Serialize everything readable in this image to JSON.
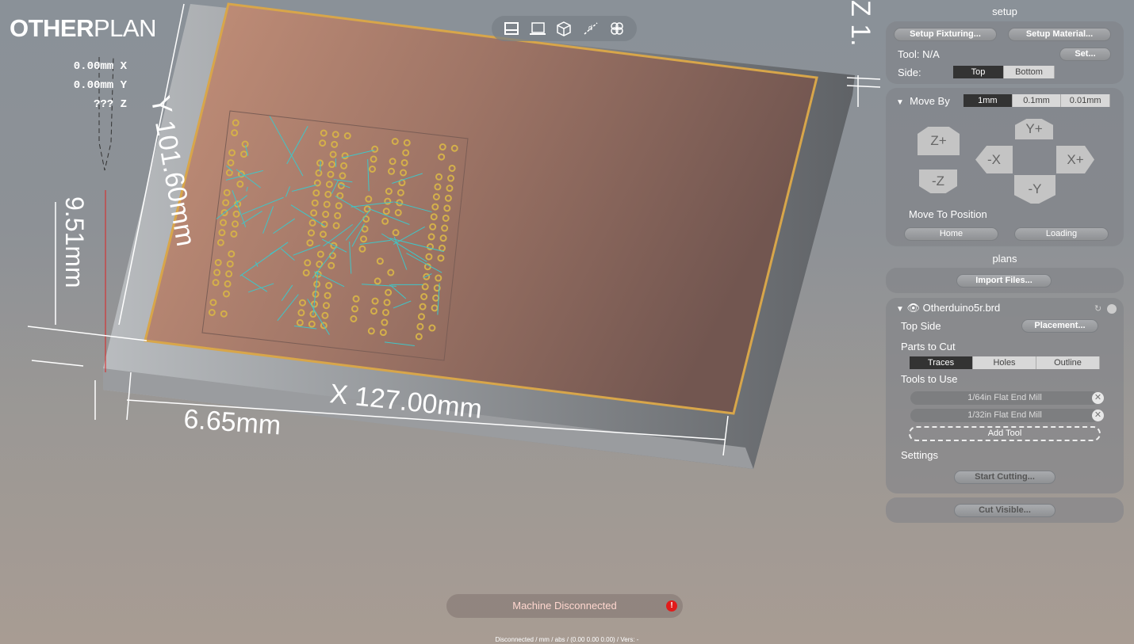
{
  "app": {
    "logo_bold": "OTHER",
    "logo_light": "PLAN"
  },
  "readout": {
    "x": "0.00mm X",
    "y": "0.00mm Y",
    "z": "??? Z"
  },
  "toolbar": {
    "icons": [
      "top-view-icon",
      "front-view-icon",
      "iso-view-icon",
      "measure-icon",
      "layers-icon"
    ]
  },
  "dimensions": {
    "y": "Y 101.60mm",
    "x": "X 127.00mm",
    "offset_y": "9.51mm",
    "offset_x": "6.65mm",
    "z": "Z 1."
  },
  "setup": {
    "title": "setup",
    "fixturing": "Setup Fixturing...",
    "material": "Setup Material...",
    "tool_label": "Tool:",
    "tool_value": "N/A",
    "set": "Set...",
    "side_label": "Side:",
    "sides": [
      "Top",
      "Bottom"
    ],
    "side_selected": "Top"
  },
  "move": {
    "label": "Move By",
    "steps": [
      "1mm",
      "0.1mm",
      "0.01mm"
    ],
    "step_selected": "1mm",
    "zplus": "Z+",
    "zminus": "-Z",
    "yplus": "Y+",
    "yminus": "-Y",
    "xplus": "X+",
    "xminus": "-X",
    "move_to": "Move To Position",
    "home": "Home",
    "loading": "Loading"
  },
  "plans": {
    "title": "plans",
    "import": "Import Files...",
    "file": "Otherduino5r.brd",
    "side": "Top Side",
    "placement": "Placement...",
    "parts_label": "Parts to Cut",
    "parts": [
      "Traces",
      "Holes",
      "Outline"
    ],
    "parts_selected": "Traces",
    "tools_label": "Tools to Use",
    "tools": [
      "1/64in Flat End Mill",
      "1/32in Flat End Mill"
    ],
    "add_tool": "Add Tool",
    "settings": "Settings",
    "start": "Start Cutting...",
    "cut_visible": "Cut Visible..."
  },
  "status": {
    "message": "Machine Disconnected",
    "footer": "Disconnected / mm / abs / (0.00 0.00 0.00) / Vers: -"
  },
  "colors": {
    "copper": "#b58873",
    "trace": "#d4b04a",
    "ratsnest": "#3fc6c8",
    "warning": "#e21b1b"
  }
}
